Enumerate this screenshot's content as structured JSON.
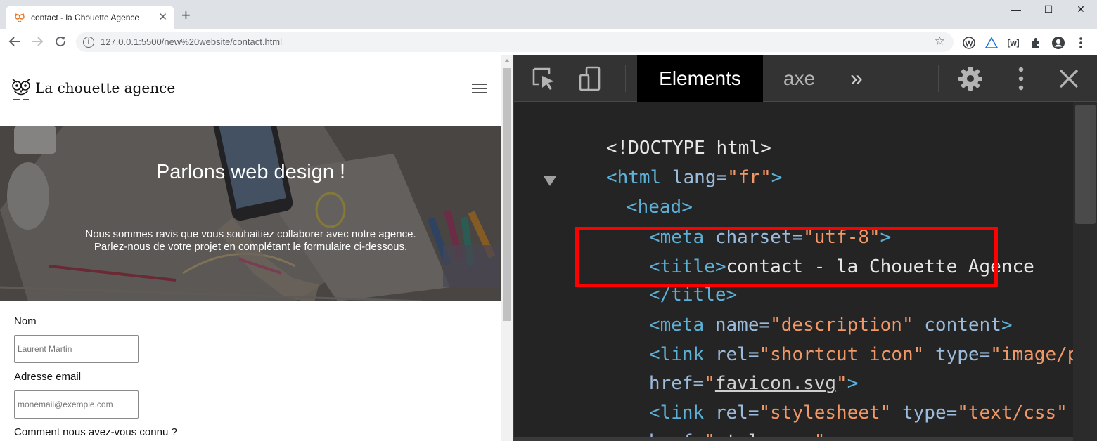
{
  "browser": {
    "tab_title": "contact - la Chouette Agence",
    "tab_close": "✕",
    "new_tab": "+",
    "url": "127.0.0.1:5500/new%20website/contact.html",
    "window": {
      "minimize": "—",
      "maximize": "☐",
      "close": "✕"
    }
  },
  "site": {
    "logo_text": "La chouette agence",
    "hero_title": "Parlons web design !",
    "hero_line1": "Nous sommes ravis que vous souhaitiez collaborer avec notre agence.",
    "hero_line2": "Parlez-nous de votre projet en complétant le formulaire ci-dessous.",
    "form": {
      "name_label": "Nom",
      "name_placeholder": "Laurent Martin",
      "email_label": "Adresse email",
      "email_placeholder": "monemail@exemple.com",
      "source_label": "Comment nous avez-vous connu ?"
    }
  },
  "devtools": {
    "tab_elements": "Elements",
    "tab_axe": "axe",
    "more_tabs": "»",
    "code": {
      "doctype": "<!DOCTYPE html>",
      "html_open": "<html",
      "html_lang_attr": " lang=",
      "html_lang_val": "\"fr\"",
      "html_close": ">",
      "head": "<head>",
      "meta_open": "<meta",
      "meta_attr": " charset=",
      "meta_val": "\"utf-8\"",
      "meta_close": ">",
      "title_open": "<title>",
      "title_text": "contact - la Chouette Agence",
      "title_close": "</title>",
      "desc_open": "<meta",
      "desc_name_attr": " name=",
      "desc_name_val": "\"description\"",
      "desc_content_attr": " content",
      "desc_close": ">",
      "link1_open": "<link",
      "link1_rel_attr": " rel=",
      "link1_rel_val": "\"shortcut icon\"",
      "link1_type_attr": " type=",
      "link1_type_val": "\"image/png\"",
      "link1_href_attr": "href=",
      "link1_href_q1": "\"",
      "link1_href_val": "favicon.svg",
      "link1_href_q2": "\"",
      "link1_close": ">",
      "link2_open": "<link",
      "link2_rel_attr": " rel=",
      "link2_rel_val": "\"stylesheet\"",
      "link2_type_attr": " type=",
      "link2_type_val": "\"text/css\"",
      "link2_href_attr": "href=",
      "link2_href_q1": "\"",
      "link2_href_val": "style.css",
      "link2_href_q2": "\"",
      "link2_close": ">"
    }
  },
  "colors": {
    "devtools_bg": "#242424",
    "tag": "#5db0d7",
    "attr": "#9bbbdc",
    "value": "#f29766",
    "highlight": "#ff0000"
  },
  "icons": [
    "favicon-owl-icon",
    "back-icon",
    "forward-icon",
    "reload-icon",
    "info-icon",
    "star-icon",
    "extension-icons",
    "profile-icon",
    "menu-icon",
    "hamburger-icon",
    "inspect-icon",
    "device-toolbar-icon",
    "settings-icon",
    "more-icon",
    "close-icon"
  ]
}
